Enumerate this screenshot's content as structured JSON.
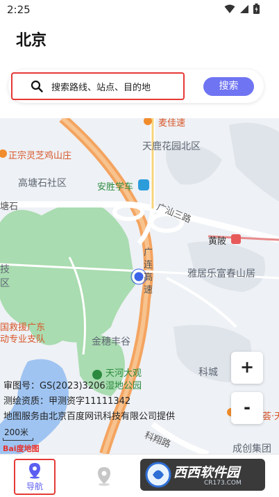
{
  "status_bar": {
    "time": "2:25"
  },
  "header": {
    "city": "北京"
  },
  "search": {
    "placeholder": "搜索路线、站点、目的地",
    "button_label": "搜索"
  },
  "map": {
    "labels": {
      "top_poi": "麦佳速",
      "residential_north": "天鹿花园北区",
      "poi_left": "正宗灵芝鸡山庄",
      "community": "高塘石社区",
      "school": "安胜学车",
      "road_left": "塘石",
      "road_guangshan": "广汕三路",
      "huangpi": "黄陂",
      "expressway": "广连高速",
      "edge_ji": "技",
      "edge_qu": "区",
      "yaju": "雅居乐富春山居",
      "rescue_line1": "国救援广东",
      "rescue_line2": "动专业支队",
      "jinsui": "金穗丰谷",
      "tianhe_line1": "天河大观",
      "tianhe_line2": "湿地公园",
      "kecheng": "科城",
      "kexiang": "科翔路",
      "bottom_right": "成创集团",
      "right_edge": "荟·天"
    },
    "zoom_in": "+",
    "zoom_out": "-",
    "info": {
      "review_no": "审图号：GS(2023)3206",
      "survey": "测绘资质：甲测资字11111342",
      "provider": "地图服务由北京百度网讯科技有限公司提供"
    },
    "scale": "200米",
    "logo_text": "Bai度地图"
  },
  "nav": {
    "navigate_label": "导航",
    "watermark_text": "西西软件园",
    "watermark_url": "CR173.COM"
  },
  "colors": {
    "accent": "#6f74f2",
    "highlight_border": "#e53935",
    "road_orange": "#f4a460",
    "green_area": "#a9dcb0"
  }
}
